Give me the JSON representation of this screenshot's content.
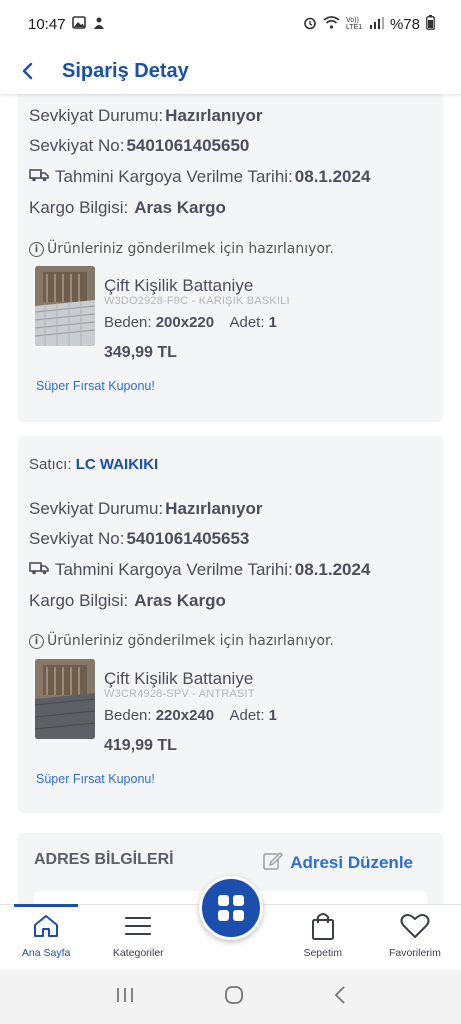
{
  "status_bar": {
    "time": "10:47",
    "battery": "%78",
    "signal_text": "Vo)) LTE1"
  },
  "app_bar": {
    "title": "Sipariş Detay"
  },
  "shipments": [
    {
      "seller_label": "",
      "seller_name": "",
      "status_label": "Sevkiyat Durumu:",
      "status_value": "Hazırlanıyor",
      "number_label": "Sevkiyat No:",
      "number_value": "5401061405650",
      "eta_label": "Tahmini Kargoya Verilme Tarihi:",
      "eta_value": "08.1.2024",
      "cargo_label": "Kargo Bilgisi:",
      "cargo_value": "Aras Kargo",
      "info_text": "Ürünleriniz gönderilmek için hazırlanıyor.",
      "product": {
        "name": "Çift Kişilik Battaniye",
        "code": "W3DO2928-F9C - KARIŞIK BASKILI",
        "size_label": "Beden:",
        "size_value": "200x220",
        "qty_label": "Adet:",
        "qty_value": "1",
        "price": "349,99 TL"
      },
      "coupon": "Süper Fırsat Kuponu!"
    },
    {
      "seller_label": "Satıcı:",
      "seller_name": "LC WAIKIKI",
      "status_label": "Sevkiyat Durumu:",
      "status_value": "Hazırlanıyor",
      "number_label": "Sevkiyat No:",
      "number_value": "5401061405653",
      "eta_label": "Tahmini Kargoya Verilme Tarihi:",
      "eta_value": "08.1.2024",
      "cargo_label": "Kargo Bilgisi:",
      "cargo_value": "Aras Kargo",
      "info_text": "Ürünleriniz gönderilmek için hazırlanıyor.",
      "product": {
        "name": "Çift Kişilik Battaniye",
        "code": "W3CR4928-SPV - ANTRASIT",
        "size_label": "Beden:",
        "size_value": "220x240",
        "qty_label": "Adet:",
        "qty_value": "1",
        "price": "419,99 TL"
      },
      "coupon": "Süper Fırsat Kuponu!"
    }
  ],
  "address": {
    "title": "ADRES BİLGİLERİ",
    "edit_label": "Adresi Düzenle"
  },
  "bottom_nav": [
    {
      "label": "Ana Sayfa",
      "icon": "home-icon",
      "active": true
    },
    {
      "label": "Kategoriler",
      "icon": "menu-icon",
      "active": false
    },
    {
      "label": "",
      "icon": "grid-icon",
      "active": false
    },
    {
      "label": "Sepetim",
      "icon": "bag-icon",
      "active": false
    },
    {
      "label": "Favorilerim",
      "icon": "heart-icon",
      "active": false
    }
  ],
  "colors": {
    "brand": "#1a4fae",
    "link": "#2b6fd6",
    "card_bg": "#f4f5f7"
  }
}
